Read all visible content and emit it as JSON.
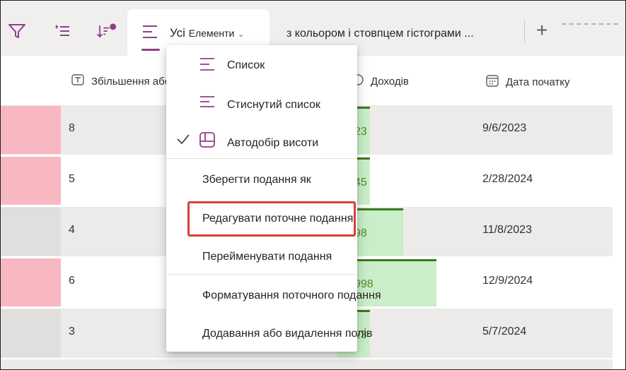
{
  "toolbar": {
    "filter_icon": "filter-icon",
    "group_icon": "group-by-icon",
    "sort_icon": "sort-icon"
  },
  "tabs": {
    "active_label": "Усі",
    "active_label_small": "Елементи",
    "second_label": "з кольором і стовпцем гістограми ..."
  },
  "columns": {
    "col1": "Збільшення або зменшення розрядності числа",
    "col2": "Доходів",
    "col3": "Дата початку"
  },
  "rows": [
    {
      "num": "8",
      "bar": "23",
      "date": "9/6/2023",
      "color": "#f8b8c1",
      "bar_fraction": 0.1
    },
    {
      "num": "5",
      "bar": "45",
      "date": "2/28/2024",
      "color": "#f8b8c1",
      "bar_fraction": 0.1
    },
    {
      "num": "4",
      "bar": "98",
      "date": "11/8/2023",
      "color": "#e1dfdd",
      "bar_fraction": 0.2
    },
    {
      "num": "6",
      "bar": "998",
      "date": "12/9/2024",
      "color": "#f8b8c1",
      "bar_fraction": 0.3
    },
    {
      "num": "3",
      "bar": "23",
      "date": "5/7/2024",
      "color": "#e1dfdd",
      "bar_fraction": 0.1
    }
  ],
  "menu": {
    "list": "Список",
    "compact_list": "Стиснутий список",
    "autofit": "Автодобір висоти",
    "save_view_as": "Зберегти подання як",
    "edit_current_view": "Редагувати поточне подання",
    "rename_view": "Перейменувати подання",
    "format_current_view": "Форматування поточного подання",
    "add_remove_columns": "Додавання або видалення полів"
  },
  "colors": {
    "accent": "#8e3f8a",
    "highlight_box": "#d9403c",
    "bar_fill": "#c9eec9",
    "bar_line": "#3c7a1b"
  }
}
